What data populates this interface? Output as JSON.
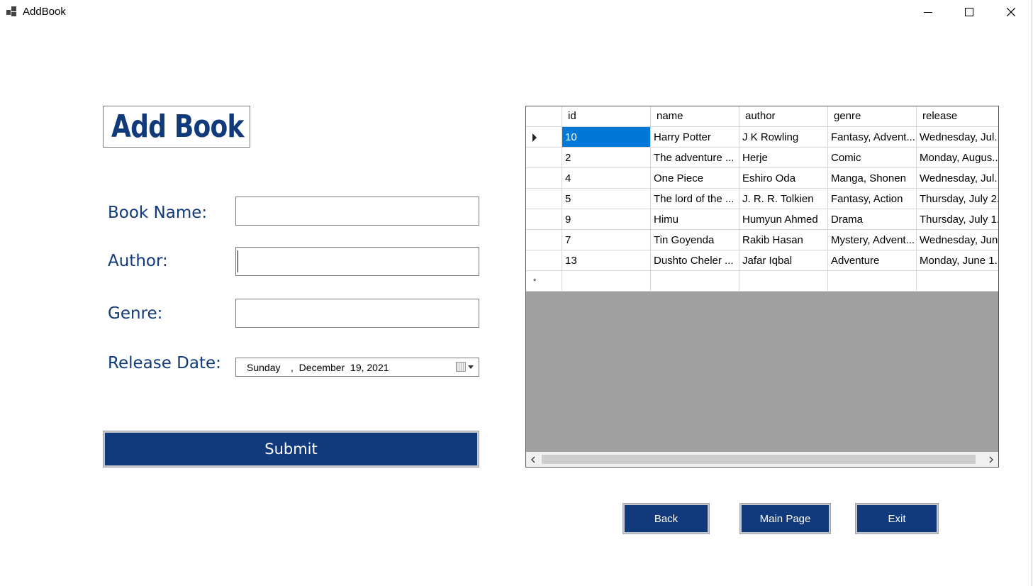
{
  "window": {
    "title": "AddBook",
    "minimize_icon": "minimize-icon",
    "maximize_icon": "maximize-icon",
    "close_icon": "close-icon"
  },
  "form": {
    "header": "Add Book",
    "book_name_label": "Book Name:",
    "book_name_value": "",
    "author_label": "Author:",
    "author_value": "",
    "genre_label": "Genre:",
    "genre_value": "",
    "release_date_label": "Release Date:",
    "release_date_day": "Sunday",
    "release_date_rest": ",  December  19, 2021",
    "calendar_icon": "calendar-icon",
    "submit_label": "Submit"
  },
  "grid": {
    "columns": [
      "id",
      "name",
      "author",
      "genre",
      "release"
    ],
    "rows": [
      [
        "10",
        "Harry Potter",
        "J K Rowling",
        "Fantasy, Advent...",
        "Wednesday, Jul..."
      ],
      [
        "2",
        "The adventure ...",
        "Herje",
        "Comic",
        "Monday, Augus..."
      ],
      [
        "4",
        "One Piece",
        "Eshiro Oda",
        "Manga, Shonen",
        "Wednesday, Jul..."
      ],
      [
        "5",
        "The lord of the ...",
        "J. R. R. Tolkien",
        "Fantasy, Action",
        "Thursday, July 2..."
      ],
      [
        "9",
        "Himu",
        "Humyun Ahmed",
        "Drama",
        "Thursday, July 1..."
      ],
      [
        "7",
        "Tin Goyenda",
        "Rakib Hasan",
        "Mystery, Advent...",
        "Wednesday, Jun..."
      ],
      [
        "13",
        "Dushto Cheler ...",
        "Jafar Iqbal",
        "Adventure",
        "Monday, June 1..."
      ]
    ],
    "selected_cell": "10"
  },
  "nav": {
    "back_label": "Back",
    "main_page_label": "Main Page",
    "exit_label": "Exit"
  },
  "colors": {
    "brand_blue": "#113a7c",
    "selection_blue": "#0078d7",
    "grid_background": "#a0a0a0"
  }
}
